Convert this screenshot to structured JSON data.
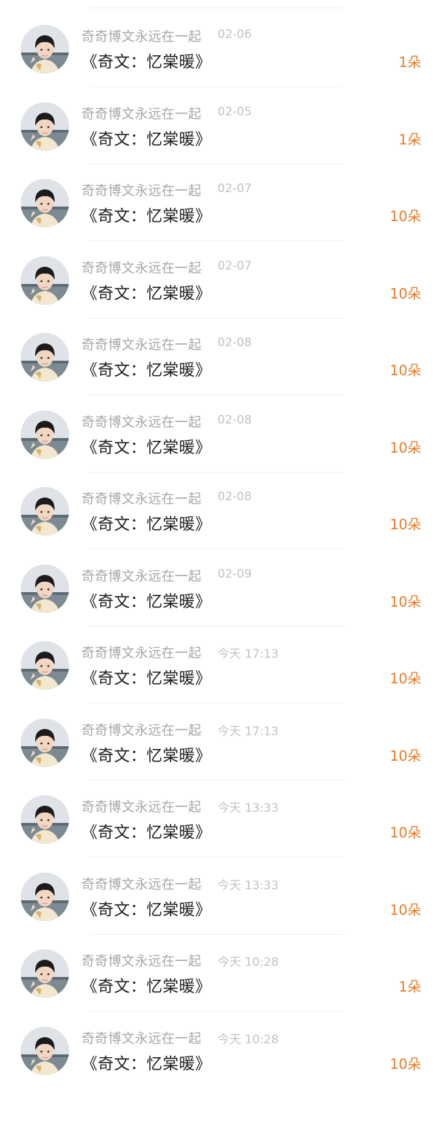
{
  "items": [
    {
      "name": "奇奇博文永远在一起",
      "time": "02-06",
      "title": "《奇文：忆棠暖》",
      "count": "1朵"
    },
    {
      "name": "奇奇博文永远在一起",
      "time": "02-05",
      "title": "《奇文：忆棠暖》",
      "count": "1朵"
    },
    {
      "name": "奇奇博文永远在一起",
      "time": "02-07",
      "title": "《奇文：忆棠暖》",
      "count": "10朵"
    },
    {
      "name": "奇奇博文永远在一起",
      "time": "02-07",
      "title": "《奇文：忆棠暖》",
      "count": "10朵"
    },
    {
      "name": "奇奇博文永远在一起",
      "time": "02-08",
      "title": "《奇文：忆棠暖》",
      "count": "10朵"
    },
    {
      "name": "奇奇博文永远在一起",
      "time": "02-08",
      "title": "《奇文：忆棠暖》",
      "count": "10朵"
    },
    {
      "name": "奇奇博文永远在一起",
      "time": "02-08",
      "title": "《奇文：忆棠暖》",
      "count": "10朵"
    },
    {
      "name": "奇奇博文永远在一起",
      "time": "02-09",
      "title": "《奇文：忆棠暖》",
      "count": "10朵"
    },
    {
      "name": "奇奇博文永远在一起",
      "time": "今天 17:13",
      "title": "《奇文：忆棠暖》",
      "count": "10朵"
    },
    {
      "name": "奇奇博文永远在一起",
      "time": "今天 17:13",
      "title": "《奇文：忆棠暖》",
      "count": "10朵"
    },
    {
      "name": "奇奇博文永远在一起",
      "time": "今天 13:33",
      "title": "《奇文：忆棠暖》",
      "count": "10朵"
    },
    {
      "name": "奇奇博文永远在一起",
      "time": "今天 13:33",
      "title": "《奇文：忆棠暖》",
      "count": "10朵"
    },
    {
      "name": "奇奇博文永远在一起",
      "time": "今天 10:28",
      "title": "《奇文：忆棠暖》",
      "count": "1朵"
    },
    {
      "name": "奇奇博文永远在一起",
      "time": "今天 10:28",
      "title": "《奇文：忆棠暖》",
      "count": "10朵"
    }
  ],
  "colors": {
    "name": "#a7a7a7",
    "time": "#c2c2c2",
    "title": "#1e1e1e",
    "count": "#ea7a25",
    "divider": "#f0f0f0"
  },
  "icons": {
    "avatar": "avatar-photo-icon"
  }
}
